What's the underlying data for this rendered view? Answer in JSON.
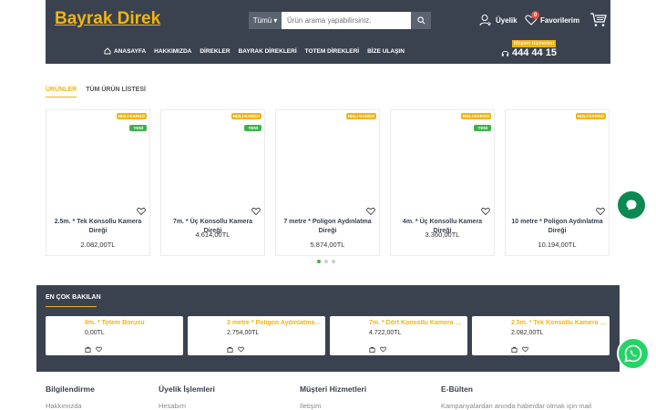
{
  "header": {
    "logo": "Bayrak Direk",
    "search": {
      "category": "Tümü",
      "placeholder": "Ürün arama yapabilirsiniz."
    },
    "user_label": "Üyelik",
    "favorites_label": "Favorilerim",
    "favorites_count": "0",
    "hotline_label": "Müşteri Hizmetleri",
    "hotline_number": "444 44 15",
    "nav": [
      "ANASAYFA",
      "HAKKIMIZDA",
      "DİREKLER",
      "BAYRAK DİREKLERİ",
      "TOTEM DİREKLERİ",
      "BİZE ULAŞIN"
    ]
  },
  "tabs": [
    "ÜRÜNLER",
    "TÜM ÜRÜN LİSTESİ"
  ],
  "products": [
    {
      "name": "2.5m. * Tek Konsollu Kamera Direği",
      "price": "2.082,00TL",
      "badges": [
        "HIZLI KARGO",
        "YENİ"
      ]
    },
    {
      "name": "7m. * Üç Konsollu Kamera Direği",
      "price": "4.614,00TL",
      "badges": [
        "HIZLI KARGO",
        "YENİ"
      ]
    },
    {
      "name": "7 metre * Poligon Aydınlatma Direği",
      "price": "5.874,00TL",
      "badges": [
        "HIZLI KARGO"
      ]
    },
    {
      "name": "4m. * Üç Konsollu Kamera Direği",
      "price": "3.360,00TL",
      "badges": [
        "HIZLI KARGO",
        "YENİ"
      ]
    },
    {
      "name": "10 metre * Poligon Aydınlatma Direği",
      "price": "10.194,00TL",
      "badges": [
        "HIZLI KARGO"
      ]
    }
  ],
  "most_viewed": {
    "title": "EN ÇOK BAKILAN",
    "items": [
      {
        "name": "9m. * Totem Borusu",
        "price": "0,00TL"
      },
      {
        "name": "3 metre * Poligon Aydınlatma D...",
        "price": "2.754,00TL"
      },
      {
        "name": "7m. * Dört Konsollu Kamera Dir...",
        "price": "4.722,00TL"
      },
      {
        "name": "2.5m. * Tek Konsollu Kamera D...",
        "price": "2.082,00TL"
      }
    ]
  },
  "footer": {
    "columns": [
      {
        "heading": "Bilgilendirme",
        "link": "Hakkımızda"
      },
      {
        "heading": "Üyelik İşlemleri",
        "link": "Hesabım"
      },
      {
        "heading": "Müşteri Hizmetleri",
        "link": "İletişim"
      },
      {
        "heading": "E-Bülten",
        "link": "Kampanyalardan anında haberdar olmak için mail"
      }
    ]
  },
  "colors": {
    "accent": "#f0b414",
    "header_bg": "#3a4250",
    "new_badge": "#3bb34a",
    "whatsapp": "#25d366"
  }
}
